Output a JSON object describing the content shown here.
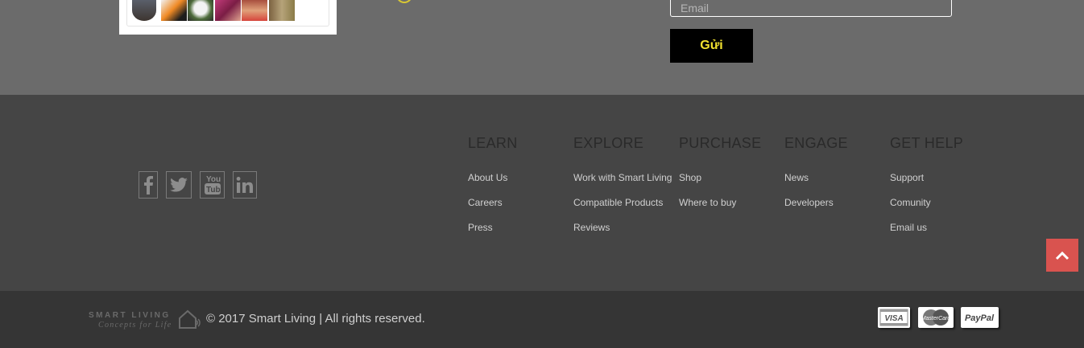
{
  "newsletter": {
    "email_placeholder": "Email",
    "send_label": "Gửi"
  },
  "social": [
    {
      "name": "facebook-icon"
    },
    {
      "name": "twitter-icon"
    },
    {
      "name": "youtube-icon"
    },
    {
      "name": "linkedin-icon"
    }
  ],
  "columns": [
    {
      "title": "LEARN",
      "links": [
        "About Us",
        "Careers",
        "Press"
      ]
    },
    {
      "title": "EXPLORE",
      "links": [
        "Work with Smart Living",
        "Compatible Products",
        "Reviews"
      ]
    },
    {
      "title": "PURCHASE",
      "links": [
        "Shop",
        "Where to buy"
      ]
    },
    {
      "title": "ENGAGE",
      "links": [
        "News",
        "Developers"
      ]
    },
    {
      "title": "GET HELP",
      "links": [
        "Support",
        "Comunity",
        "Email us"
      ]
    }
  ],
  "footer": {
    "logo_line1": "SMART LIVING",
    "logo_line2": "Concepts for Life",
    "copyright": "© 2017 Smart Living | All rights reserved."
  },
  "payments": {
    "visa": "VISA",
    "mastercard": "MasterCard",
    "paypal": "PayPal"
  },
  "colors": {
    "top_band": "#6b6b6b",
    "footer": "#454545",
    "bottom_bar": "#353535",
    "send_text": "#f2e12f",
    "back_to_top": "#d9534f"
  }
}
